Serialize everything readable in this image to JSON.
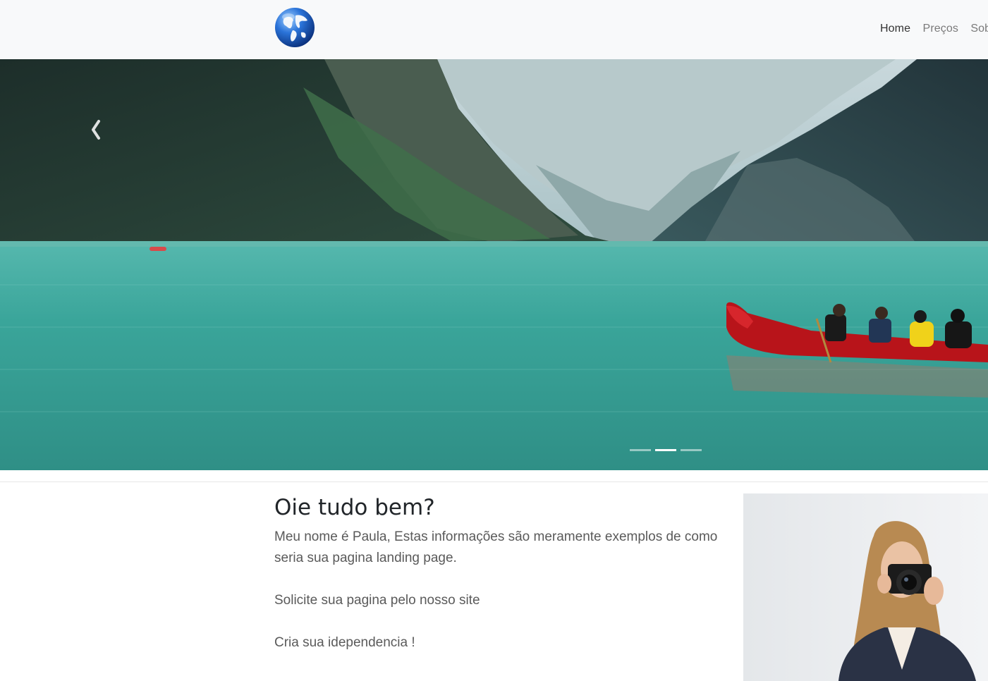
{
  "navbar": {
    "logo_icon": "globe-icon",
    "links": [
      {
        "label": "Home",
        "active": true
      },
      {
        "label": "Preços",
        "active": false
      },
      {
        "label": "Sobre",
        "active": false
      }
    ]
  },
  "carousel": {
    "prev_icon": "chevron-left-icon",
    "indicators": [
      {
        "active": false
      },
      {
        "active": true
      },
      {
        "active": false
      }
    ]
  },
  "content": {
    "headline": "Oie tudo bem?",
    "paragraph1": "Meu nome é Paula, Estas informações são meramente exemplos de como seria sua pagina landing page.",
    "paragraph2": "Solicite sua pagina pelo nosso site",
    "paragraph3": "Cria sua idependencia !"
  },
  "colors": {
    "navbar_bg": "#f8f9fa",
    "nav_active": "#333333",
    "nav_inactive": "#7a7a7a",
    "lake": "#3aa59a"
  }
}
